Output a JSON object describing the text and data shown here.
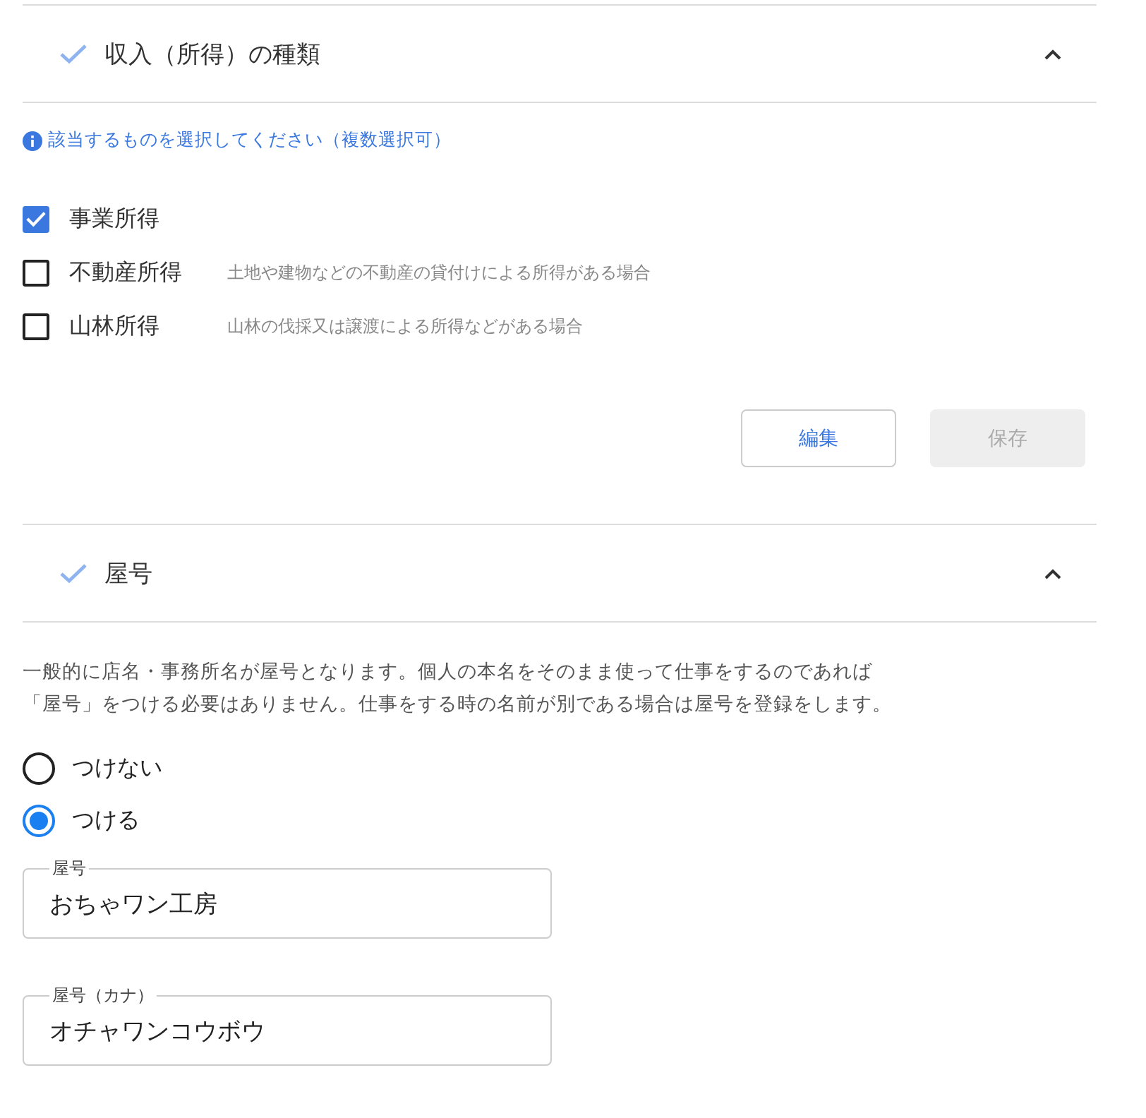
{
  "sections": [
    {
      "title": "収入（所得）の種類",
      "completed": true,
      "expanded": true,
      "kind": "income"
    },
    {
      "title": "屋号",
      "completed": true,
      "expanded": true,
      "kind": "trade_name"
    }
  ],
  "income": {
    "info": "該当するものを選択してください（複数選択可）",
    "options": [
      {
        "label": "事業所得",
        "checked": true
      },
      {
        "label": "不動産所得",
        "checked": false,
        "hint": "土地や建物などの不動産の貸付けによる所得がある場合"
      },
      {
        "label": "山林所得",
        "checked": false,
        "hint": "山林の伐採又は譲渡による所得などがある場合"
      }
    ],
    "buttons": [
      {
        "label": "編集",
        "disabled": false
      },
      {
        "label": "保存",
        "disabled": true
      }
    ]
  },
  "trade_name": {
    "description": [
      "一般的に店名・事務所名が屋号となります。個人の本名をそのまま使って仕事をするのであれば",
      "「屋号」をつける必要はありません。仕事をする時の名前が別である場合は屋号を登録をします。"
    ],
    "choices": [
      {
        "label": "つけない",
        "selected": false
      },
      {
        "label": "つける",
        "selected": true
      }
    ],
    "fields": [
      {
        "label": "屋号",
        "value": "おちゃワン工房"
      },
      {
        "label": "屋号（カナ）",
        "value": "オチャワンコウボウ"
      }
    ]
  }
}
